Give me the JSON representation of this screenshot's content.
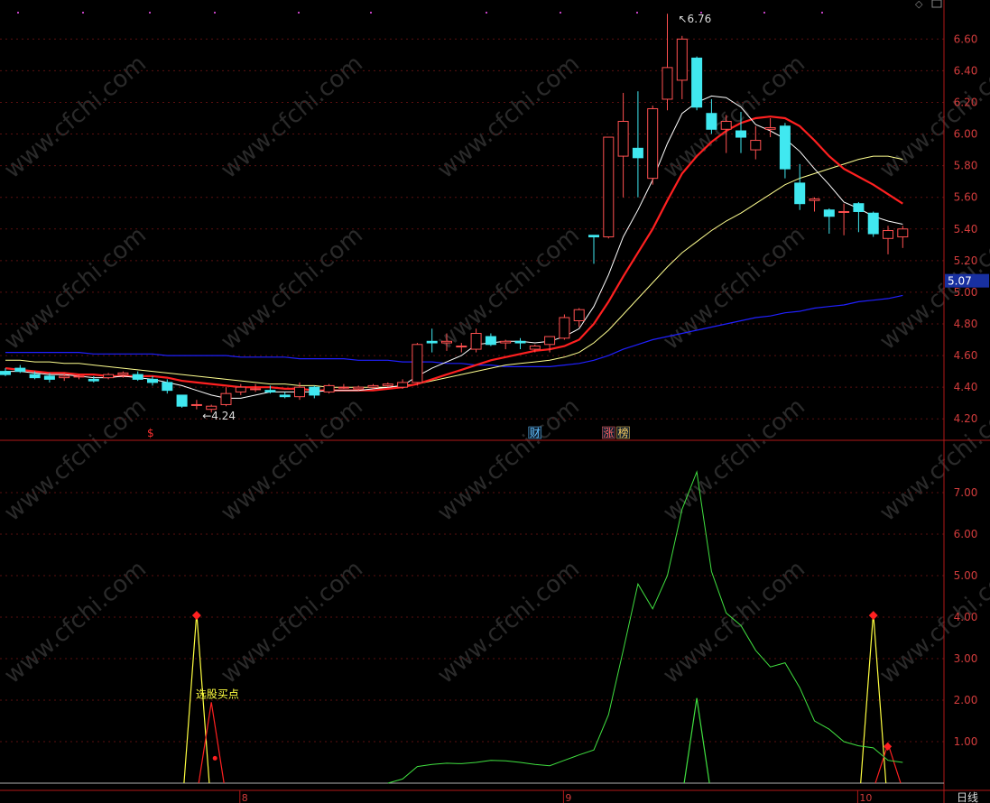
{
  "chart_data": [
    {
      "type": "candlestick",
      "panel": "price",
      "ylim": [
        4.15,
        6.75
      ],
      "y_ticks": [
        "4.20",
        "4.40",
        "4.60",
        "4.80",
        "5.00",
        "5.20",
        "5.40",
        "5.60",
        "5.80",
        "6.00",
        "6.20",
        "6.40",
        "6.60"
      ],
      "current_price": "5.07",
      "high_label": "6.76",
      "low_label": "4.24",
      "candles": [
        {
          "o": 4.5,
          "h": 4.52,
          "l": 4.47,
          "c": 4.48
        },
        {
          "o": 4.52,
          "h": 4.54,
          "l": 4.49,
          "c": 4.5
        },
        {
          "o": 4.48,
          "h": 4.5,
          "l": 4.45,
          "c": 4.46
        },
        {
          "o": 4.47,
          "h": 4.49,
          "l": 4.43,
          "c": 4.45
        },
        {
          "o": 4.46,
          "h": 4.49,
          "l": 4.44,
          "c": 4.47
        },
        {
          "o": 4.47,
          "h": 4.48,
          "l": 4.45,
          "c": 4.47
        },
        {
          "o": 4.45,
          "h": 4.47,
          "l": 4.43,
          "c": 4.44
        },
        {
          "o": 4.46,
          "h": 4.49,
          "l": 4.45,
          "c": 4.48
        },
        {
          "o": 4.48,
          "h": 4.5,
          "l": 4.46,
          "c": 4.49
        },
        {
          "o": 4.48,
          "h": 4.5,
          "l": 4.44,
          "c": 4.45
        },
        {
          "o": 4.45,
          "h": 4.47,
          "l": 4.41,
          "c": 4.43
        },
        {
          "o": 4.43,
          "h": 4.45,
          "l": 4.36,
          "c": 4.38
        },
        {
          "o": 4.35,
          "h": 4.35,
          "l": 4.27,
          "c": 4.28
        },
        {
          "o": 4.29,
          "h": 4.32,
          "l": 4.26,
          "c": 4.29
        },
        {
          "o": 4.26,
          "h": 4.29,
          "l": 4.24,
          "c": 4.28
        },
        {
          "o": 4.29,
          "h": 4.4,
          "l": 4.28,
          "c": 4.36
        },
        {
          "o": 4.37,
          "h": 4.42,
          "l": 4.35,
          "c": 4.4
        },
        {
          "o": 4.39,
          "h": 4.42,
          "l": 4.37,
          "c": 4.39
        },
        {
          "o": 4.38,
          "h": 4.41,
          "l": 4.36,
          "c": 4.37
        },
        {
          "o": 4.35,
          "h": 4.37,
          "l": 4.33,
          "c": 4.34
        },
        {
          "o": 4.34,
          "h": 4.43,
          "l": 4.32,
          "c": 4.4
        },
        {
          "o": 4.4,
          "h": 4.41,
          "l": 4.33,
          "c": 4.35
        },
        {
          "o": 4.37,
          "h": 4.42,
          "l": 4.36,
          "c": 4.41
        },
        {
          "o": 4.4,
          "h": 4.42,
          "l": 4.39,
          "c": 4.4
        },
        {
          "o": 4.39,
          "h": 4.41,
          "l": 4.38,
          "c": 4.4
        },
        {
          "o": 4.4,
          "h": 4.42,
          "l": 4.39,
          "c": 4.41
        },
        {
          "o": 4.41,
          "h": 4.43,
          "l": 4.4,
          "c": 4.42
        },
        {
          "o": 4.4,
          "h": 4.45,
          "l": 4.39,
          "c": 4.43
        },
        {
          "o": 4.43,
          "h": 4.68,
          "l": 4.41,
          "c": 4.67
        },
        {
          "o": 4.69,
          "h": 4.77,
          "l": 4.62,
          "c": 4.68
        },
        {
          "o": 4.68,
          "h": 4.74,
          "l": 4.63,
          "c": 4.69
        },
        {
          "o": 4.66,
          "h": 4.68,
          "l": 4.62,
          "c": 4.66
        },
        {
          "o": 4.64,
          "h": 4.77,
          "l": 4.62,
          "c": 4.74
        },
        {
          "o": 4.72,
          "h": 4.74,
          "l": 4.66,
          "c": 4.67
        },
        {
          "o": 4.68,
          "h": 4.7,
          "l": 4.64,
          "c": 4.69
        },
        {
          "o": 4.69,
          "h": 4.71,
          "l": 4.64,
          "c": 4.68
        },
        {
          "o": 4.64,
          "h": 4.67,
          "l": 4.62,
          "c": 4.66
        },
        {
          "o": 4.67,
          "h": 4.72,
          "l": 4.62,
          "c": 4.72
        },
        {
          "o": 4.71,
          "h": 4.86,
          "l": 4.7,
          "c": 4.84
        },
        {
          "o": 4.82,
          "h": 4.9,
          "l": 4.78,
          "c": 4.89
        },
        {
          "o": 5.36,
          "h": 5.36,
          "l": 5.18,
          "c": 5.35
        },
        {
          "o": 5.35,
          "h": 5.98,
          "l": 5.34,
          "c": 5.98
        },
        {
          "o": 5.86,
          "h": 6.26,
          "l": 5.6,
          "c": 6.08
        },
        {
          "o": 5.91,
          "h": 6.27,
          "l": 5.6,
          "c": 5.85
        },
        {
          "o": 5.72,
          "h": 6.18,
          "l": 5.68,
          "c": 6.16
        },
        {
          "o": 6.22,
          "h": 6.76,
          "l": 6.15,
          "c": 6.42
        },
        {
          "o": 6.34,
          "h": 6.62,
          "l": 6.22,
          "c": 6.6
        },
        {
          "o": 6.48,
          "h": 6.49,
          "l": 6.15,
          "c": 6.17
        },
        {
          "o": 6.13,
          "h": 6.22,
          "l": 6.0,
          "c": 6.03
        },
        {
          "o": 6.03,
          "h": 6.12,
          "l": 5.88,
          "c": 6.08
        },
        {
          "o": 6.02,
          "h": 6.14,
          "l": 5.88,
          "c": 5.98
        },
        {
          "o": 5.9,
          "h": 6.05,
          "l": 5.84,
          "c": 5.96
        },
        {
          "o": 6.03,
          "h": 6.1,
          "l": 5.98,
          "c": 6.04
        },
        {
          "o": 6.05,
          "h": 6.07,
          "l": 5.72,
          "c": 5.78
        },
        {
          "o": 5.69,
          "h": 5.81,
          "l": 5.52,
          "c": 5.56
        },
        {
          "o": 5.58,
          "h": 5.6,
          "l": 5.51,
          "c": 5.59
        },
        {
          "o": 5.52,
          "h": 5.53,
          "l": 5.37,
          "c": 5.48
        },
        {
          "o": 5.51,
          "h": 5.56,
          "l": 5.36,
          "c": 5.51
        },
        {
          "o": 5.56,
          "h": 5.57,
          "l": 5.38,
          "c": 5.51
        },
        {
          "o": 5.5,
          "h": 5.51,
          "l": 5.35,
          "c": 5.37
        },
        {
          "o": 5.34,
          "h": 5.42,
          "l": 5.24,
          "c": 5.39
        },
        {
          "o": 5.35,
          "h": 5.42,
          "l": 5.28,
          "c": 5.4
        }
      ],
      "ma_white": [
        4.5,
        4.5,
        4.49,
        4.48,
        4.48,
        4.47,
        4.46,
        4.46,
        4.47,
        4.46,
        4.45,
        4.43,
        4.41,
        4.38,
        4.35,
        4.33,
        4.33,
        4.35,
        4.37,
        4.37,
        4.37,
        4.37,
        4.38,
        4.38,
        4.38,
        4.39,
        4.4,
        4.41,
        4.47,
        4.52,
        4.56,
        4.6,
        4.67,
        4.68,
        4.69,
        4.69,
        4.68,
        4.69,
        4.72,
        4.77,
        4.91,
        5.11,
        5.35,
        5.52,
        5.71,
        5.94,
        6.13,
        6.2,
        6.24,
        6.23,
        6.17,
        6.06,
        6.02,
        5.97,
        5.89,
        5.78,
        5.68,
        5.57,
        5.53,
        5.48,
        5.45,
        5.43
      ],
      "ma_red": [
        4.52,
        4.51,
        4.5,
        4.49,
        4.49,
        4.48,
        4.48,
        4.47,
        4.47,
        4.47,
        4.47,
        4.46,
        4.44,
        4.43,
        4.42,
        4.41,
        4.4,
        4.4,
        4.4,
        4.39,
        4.39,
        4.38,
        4.38,
        4.38,
        4.38,
        4.38,
        4.39,
        4.4,
        4.42,
        4.45,
        4.48,
        4.51,
        4.54,
        4.57,
        4.59,
        4.61,
        4.63,
        4.64,
        4.66,
        4.7,
        4.8,
        4.94,
        5.1,
        5.25,
        5.4,
        5.58,
        5.75,
        5.86,
        5.95,
        6.02,
        6.07,
        6.1,
        6.11,
        6.1,
        6.05,
        5.96,
        5.86,
        5.78,
        5.73,
        5.68,
        5.62,
        5.56
      ],
      "ma_yellow": [
        4.57,
        4.57,
        4.56,
        4.56,
        4.55,
        4.55,
        4.54,
        4.53,
        4.52,
        4.51,
        4.5,
        4.49,
        4.48,
        4.47,
        4.46,
        4.45,
        4.44,
        4.43,
        4.42,
        4.42,
        4.41,
        4.41,
        4.4,
        4.4,
        4.4,
        4.4,
        4.4,
        4.41,
        4.42,
        4.44,
        4.46,
        4.48,
        4.5,
        4.52,
        4.54,
        4.55,
        4.56,
        4.57,
        4.59,
        4.62,
        4.68,
        4.76,
        4.86,
        4.96,
        5.06,
        5.16,
        5.25,
        5.32,
        5.39,
        5.45,
        5.5,
        5.56,
        5.62,
        5.68,
        5.72,
        5.75,
        5.78,
        5.81,
        5.84,
        5.86,
        5.86,
        5.84
      ],
      "ma_blue": [
        4.62,
        4.62,
        4.62,
        4.62,
        4.62,
        4.62,
        4.61,
        4.61,
        4.61,
        4.61,
        4.61,
        4.6,
        4.6,
        4.6,
        4.6,
        4.6,
        4.59,
        4.59,
        4.59,
        4.59,
        4.58,
        4.58,
        4.58,
        4.58,
        4.57,
        4.57,
        4.57,
        4.56,
        4.56,
        4.56,
        4.55,
        4.55,
        4.54,
        4.54,
        4.53,
        4.53,
        4.53,
        4.53,
        4.54,
        4.55,
        4.57,
        4.6,
        4.64,
        4.67,
        4.7,
        4.72,
        4.74,
        4.76,
        4.78,
        4.8,
        4.82,
        4.84,
        4.85,
        4.87,
        4.88,
        4.9,
        4.91,
        4.92,
        4.94,
        4.95,
        4.96,
        4.98
      ],
      "markers": [
        {
          "index": 10,
          "text": "$",
          "color": "#ff3030"
        },
        {
          "index": 36,
          "text": "财",
          "color": "#60c0ff"
        },
        {
          "index": 41,
          "text": "涨",
          "color": "#ff6060"
        },
        {
          "index": 42,
          "text": "榜",
          "color": "#ffd060"
        }
      ],
      "colors": {
        "up": "#ff5050",
        "down": "#40e8f0",
        "ma_white": "#ffffff",
        "ma_red": "#ff2020",
        "ma_yellow": "#ffff90",
        "ma_blue": "#2020ff"
      }
    },
    {
      "type": "line",
      "panel": "indicator",
      "ylim": [
        0,
        8
      ],
      "y_ticks": [
        "1.00",
        "2.00",
        "3.00",
        "4.00",
        "5.00",
        "6.00",
        "7.00"
      ],
      "green_series": [
        0,
        0,
        0,
        0,
        0,
        0,
        0,
        0,
        0,
        0,
        0,
        0,
        0,
        0,
        0,
        0,
        0,
        0,
        0,
        0,
        0,
        0,
        0,
        0,
        0,
        0,
        0,
        0.1,
        0.4,
        0.45,
        0.48,
        0.47,
        0.5,
        0.55,
        0.54,
        0.5,
        0.45,
        0.42,
        0.55,
        0.68,
        0.8,
        1.65,
        3.2,
        4.8,
        4.2,
        5.0,
        6.6,
        7.5,
        5.1,
        4.1,
        3.8,
        3.2,
        2.8,
        2.9,
        2.3,
        1.5,
        1.3,
        1.0,
        0.9,
        0.85,
        0.55,
        0.5
      ],
      "yellow_spike_indices": [
        13,
        59
      ],
      "yellow_spike_value": 4.1,
      "red_spike_indices": [
        14,
        60
      ],
      "red_spike_values": [
        1.95,
        0.95
      ],
      "green_spike_index": 47,
      "green_spike_value": 2.05,
      "annotation": "选股买点",
      "x_labels": [
        {
          "index": 16,
          "text": "8"
        },
        {
          "index": 38,
          "text": "9"
        },
        {
          "index": 58,
          "text": "10"
        }
      ],
      "period_label": "日线",
      "colors": {
        "green": "#40e040",
        "yellow": "#ffff40",
        "red": "#ff2020"
      }
    }
  ],
  "watermark": "www.cfchi.com"
}
